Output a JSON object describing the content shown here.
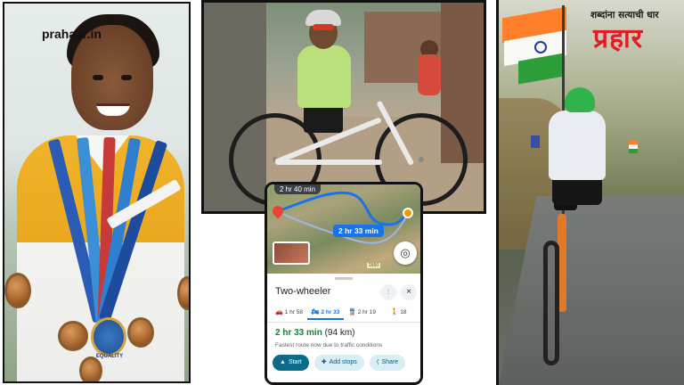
{
  "left_panel": {
    "logo": "prahaar.in",
    "badge_text": "EQUALITY"
  },
  "map_card": {
    "top_chip": "2 hr 40 min",
    "route_label": "2 hr 33 min",
    "map_scale": "1660",
    "title": "Two-wheeler",
    "modes": [
      {
        "icon": "car-icon",
        "glyph": "🚗",
        "label": "1 hr 58"
      },
      {
        "icon": "motorbike-icon",
        "glyph": "🏍",
        "label": "2 hr 33"
      },
      {
        "icon": "transit-icon",
        "glyph": "🚆",
        "label": "2 hr 19"
      },
      {
        "icon": "walk-icon",
        "glyph": "🚶",
        "label": "18"
      }
    ],
    "eta_time": "2 hr 33 min",
    "eta_distance": "(94 km)",
    "note": "Fastest route now due to traffic conditions",
    "actions": {
      "start": "Start",
      "add_stops": "Add stops",
      "share": "Share"
    }
  },
  "right_panel": {
    "brand_tagline": "शब्दांना सत्याची धार",
    "brand_name": "प्रहार"
  },
  "colors": {
    "brand_red": "#e01c24",
    "route_blue": "#1a73e8",
    "eta_green": "#188038",
    "start_button": "#0b6b88"
  }
}
